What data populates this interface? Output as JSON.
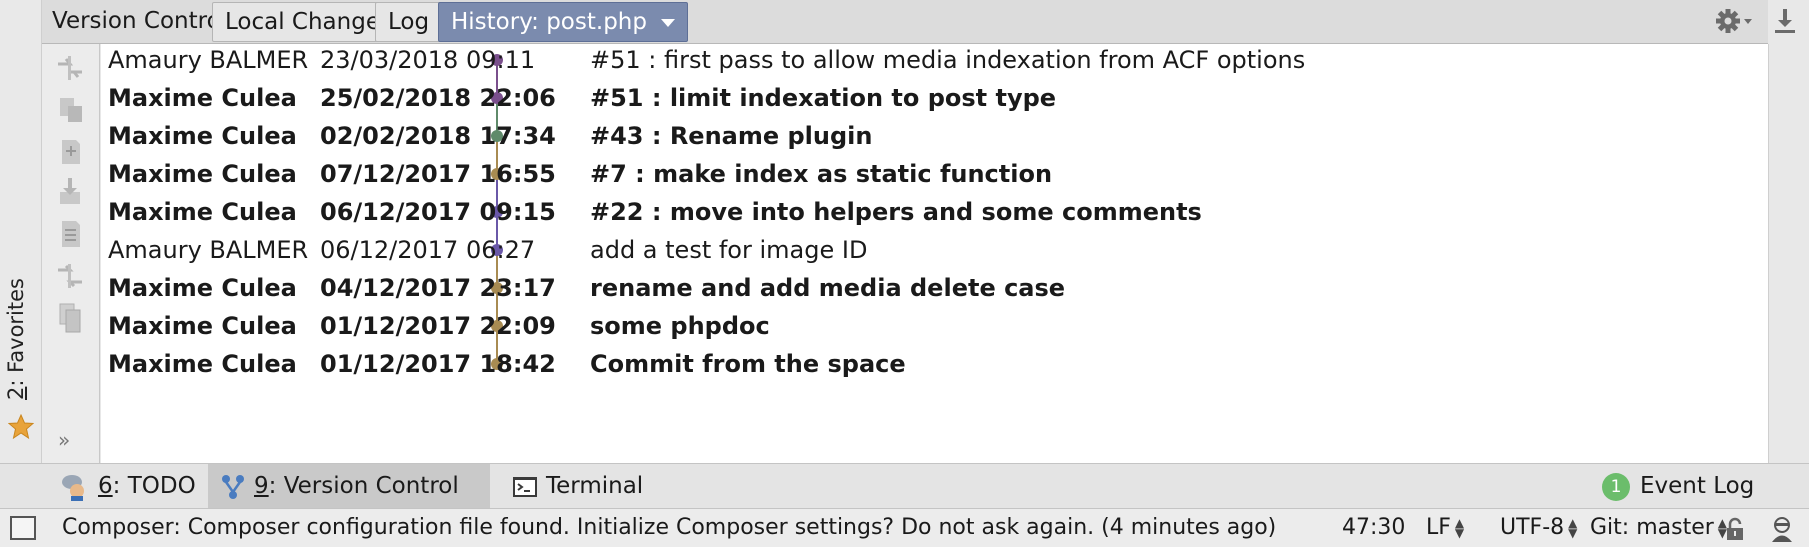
{
  "window": {
    "favorites_number": "2",
    "favorites_label": ": Favorites"
  },
  "tabbar": {
    "prefix": "Version Control:",
    "tabs": [
      {
        "label": "Local Changes"
      },
      {
        "label": "Log"
      },
      {
        "label": "History: post.php",
        "active": true
      }
    ]
  },
  "log": {
    "rows": [
      {
        "author": "Amaury BALMER",
        "date": "23/03/2018 09:11",
        "message": "#51 : first pass to allow media indexation from ACF options",
        "bold": false,
        "color": "#7a4f8c"
      },
      {
        "author": "Maxime Culea",
        "date": "25/02/2018 22:06",
        "message": "#51 : limit indexation to post type",
        "bold": true,
        "color": "#7a4f8c"
      },
      {
        "author": "Maxime Culea",
        "date": "02/02/2018 17:34",
        "message": "#43 : Rename plugin",
        "bold": true,
        "color": "#5f8a6a"
      },
      {
        "author": "Maxime Culea",
        "date": "07/12/2017 16:55",
        "message": "#7 : make index as static function",
        "bold": true,
        "color": "#a88b52"
      },
      {
        "author": "Maxime Culea",
        "date": "06/12/2017 09:15",
        "message": "#22 : move into helpers and some comments",
        "bold": true,
        "color": "#6a58a8"
      },
      {
        "author": "Amaury BALMER",
        "date": "06/12/2017 06:27",
        "message": "add a test for image ID",
        "bold": false,
        "color": "#6a58a8"
      },
      {
        "author": "Maxime Culea",
        "date": "04/12/2017 23:17",
        "message": "rename and add media delete case",
        "bold": true,
        "color": "#a88b52"
      },
      {
        "author": "Maxime Culea",
        "date": "01/12/2017 22:09",
        "message": "some phpdoc",
        "bold": true,
        "color": "#a88b52"
      },
      {
        "author": "Maxime Culea",
        "date": "01/12/2017 18:42",
        "message": "Commit from the space",
        "bold": true,
        "color": "#a88b52"
      }
    ]
  },
  "toolwindows": {
    "todo_number": "6",
    "todo_label": ": TODO",
    "vc_number": "9",
    "vc_label": ": Version Control",
    "terminal_label": "Terminal",
    "event_count": "1",
    "event_label": "Event Log"
  },
  "status": {
    "message": "Composer: Composer configuration file found. Initialize Composer settings? Do not ask again. (4 minutes ago)",
    "position": "47:30",
    "line_sep": "LF",
    "encoding": "UTF-8",
    "branch": "Git: master"
  },
  "colors": {
    "active_tab": "#7b8bae",
    "badge": "#6bbd6b"
  }
}
